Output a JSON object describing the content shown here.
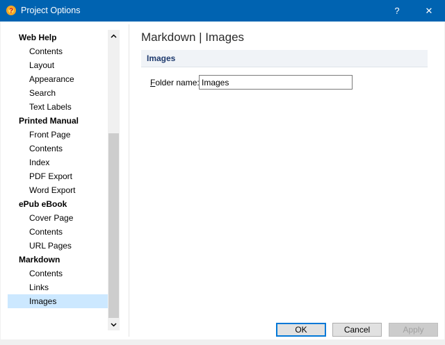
{
  "window": {
    "title": "Project Options",
    "help_glyph": "?",
    "close_glyph": "✕"
  },
  "colors": {
    "titlebar": "#0063b1",
    "selection": "#cce8ff",
    "accent": "#0078d7",
    "section_title": "#1e3a6e"
  },
  "tree": {
    "items": [
      {
        "label": "Web Help",
        "type": "group"
      },
      {
        "label": "Contents",
        "type": "child"
      },
      {
        "label": "Layout",
        "type": "child"
      },
      {
        "label": "Appearance",
        "type": "child"
      },
      {
        "label": "Search",
        "type": "child"
      },
      {
        "label": "Text Labels",
        "type": "child"
      },
      {
        "label": "Printed Manual",
        "type": "group"
      },
      {
        "label": "Front Page",
        "type": "child"
      },
      {
        "label": "Contents",
        "type": "child"
      },
      {
        "label": "Index",
        "type": "child"
      },
      {
        "label": "PDF Export",
        "type": "child"
      },
      {
        "label": "Word Export",
        "type": "child"
      },
      {
        "label": "ePub eBook",
        "type": "group"
      },
      {
        "label": "Cover Page",
        "type": "child"
      },
      {
        "label": "Contents",
        "type": "child"
      },
      {
        "label": "URL Pages",
        "type": "child"
      },
      {
        "label": "Markdown",
        "type": "group"
      },
      {
        "label": "Contents",
        "type": "child"
      },
      {
        "label": "Links",
        "type": "child"
      },
      {
        "label": "Images",
        "type": "child",
        "selected": true
      }
    ]
  },
  "main": {
    "page_title": "Markdown | Images",
    "section_title": "Images",
    "folder_label": "Folder name:",
    "folder_value": "Images"
  },
  "buttons": {
    "ok": "OK",
    "cancel": "Cancel",
    "apply": "Apply"
  }
}
